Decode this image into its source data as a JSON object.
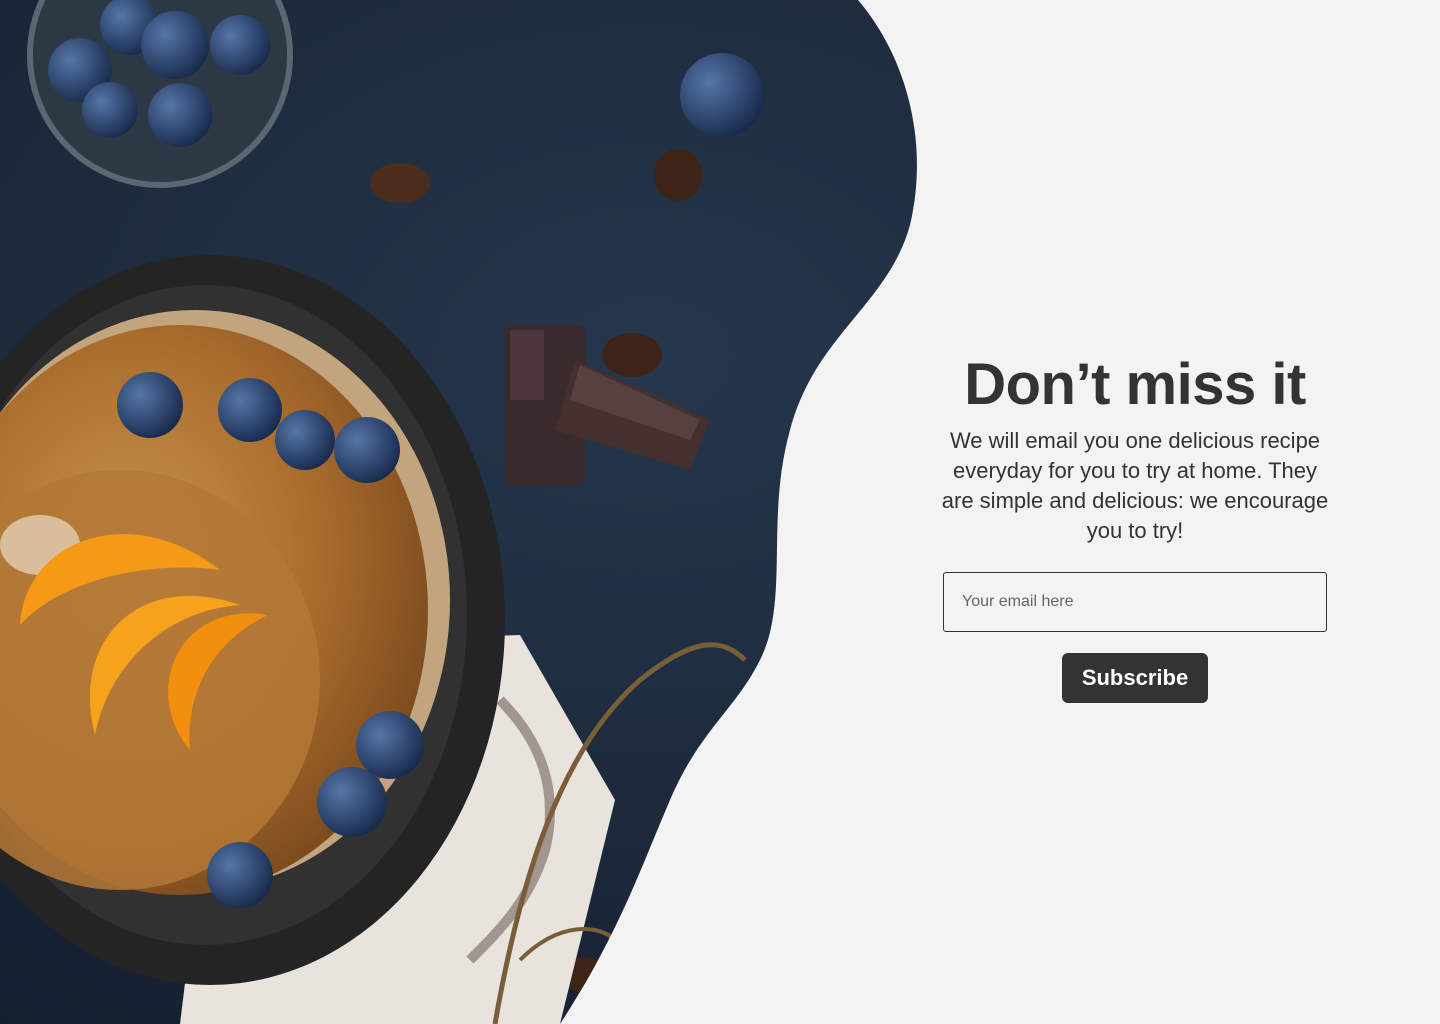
{
  "hero": {
    "image_subject": "cast-iron skillet of pancakes topped with blueberries and orange slices, chocolate pieces and coffee beans on a dark table"
  },
  "signup": {
    "headline": "Don’t miss it",
    "body": "We will email you one delicious recipe everyday for you to try at home. They are simple and delicious: we encourage you to try!",
    "email_placeholder": "Your email here",
    "subscribe_label": "Subscribe"
  },
  "colors": {
    "page_background": "#f3f3f3",
    "text": "#333333",
    "button_background": "#333333",
    "button_text": "#ffffff",
    "photo_background": "#1c2a3c"
  }
}
